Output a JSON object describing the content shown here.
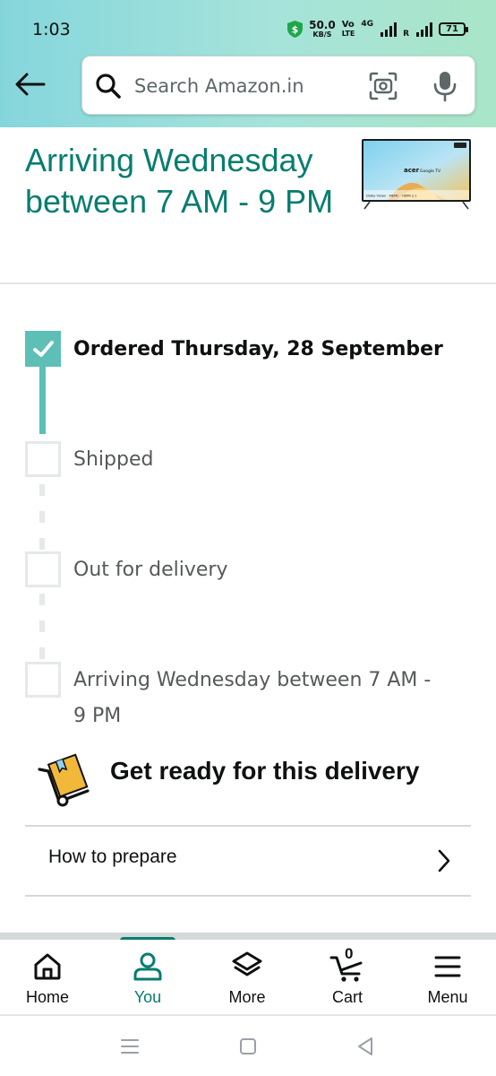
{
  "status_bar": {
    "time": "1:03",
    "net_speed_value": "50.0",
    "net_speed_unit": "KB/S",
    "volte_top": "Vo",
    "volte_bottom": "LTE",
    "network_type": "4G",
    "signal2_label": "R",
    "battery": "71"
  },
  "search": {
    "placeholder": "Search Amazon.in"
  },
  "arrival": {
    "heading": "Arriving Wednesday between 7 AM - 9 PM",
    "product_image": "acer-google-tv-thumbnail"
  },
  "tracker": {
    "steps": [
      {
        "label": "Ordered Thursday, 28 September",
        "done": true
      },
      {
        "label": "Shipped",
        "done": false
      },
      {
        "label": "Out for delivery",
        "done": false
      },
      {
        "label": "Arriving Wednesday between 7 AM - 9 PM",
        "done": false
      }
    ],
    "step4_line1": "Arriving Wednesday between 7 AM -",
    "step4_line2": "9 PM"
  },
  "get_ready": {
    "title": "Get ready for this delivery",
    "how_to_prepare": "How to prepare"
  },
  "bottom_nav": {
    "items": [
      {
        "label": "Home",
        "icon": "home-icon",
        "active": false
      },
      {
        "label": "You",
        "icon": "user-icon",
        "active": true
      },
      {
        "label": "More",
        "icon": "layers-icon",
        "active": false
      },
      {
        "label": "Cart",
        "icon": "cart-icon",
        "active": false,
        "badge": "0"
      },
      {
        "label": "Menu",
        "icon": "hamburger-icon",
        "active": false
      }
    ]
  },
  "colors": {
    "accent": "#067d6f",
    "tracker_done": "#5dbfb5",
    "header_gradient_start": "#85d6dc",
    "header_gradient_end": "#a9e5c7"
  }
}
